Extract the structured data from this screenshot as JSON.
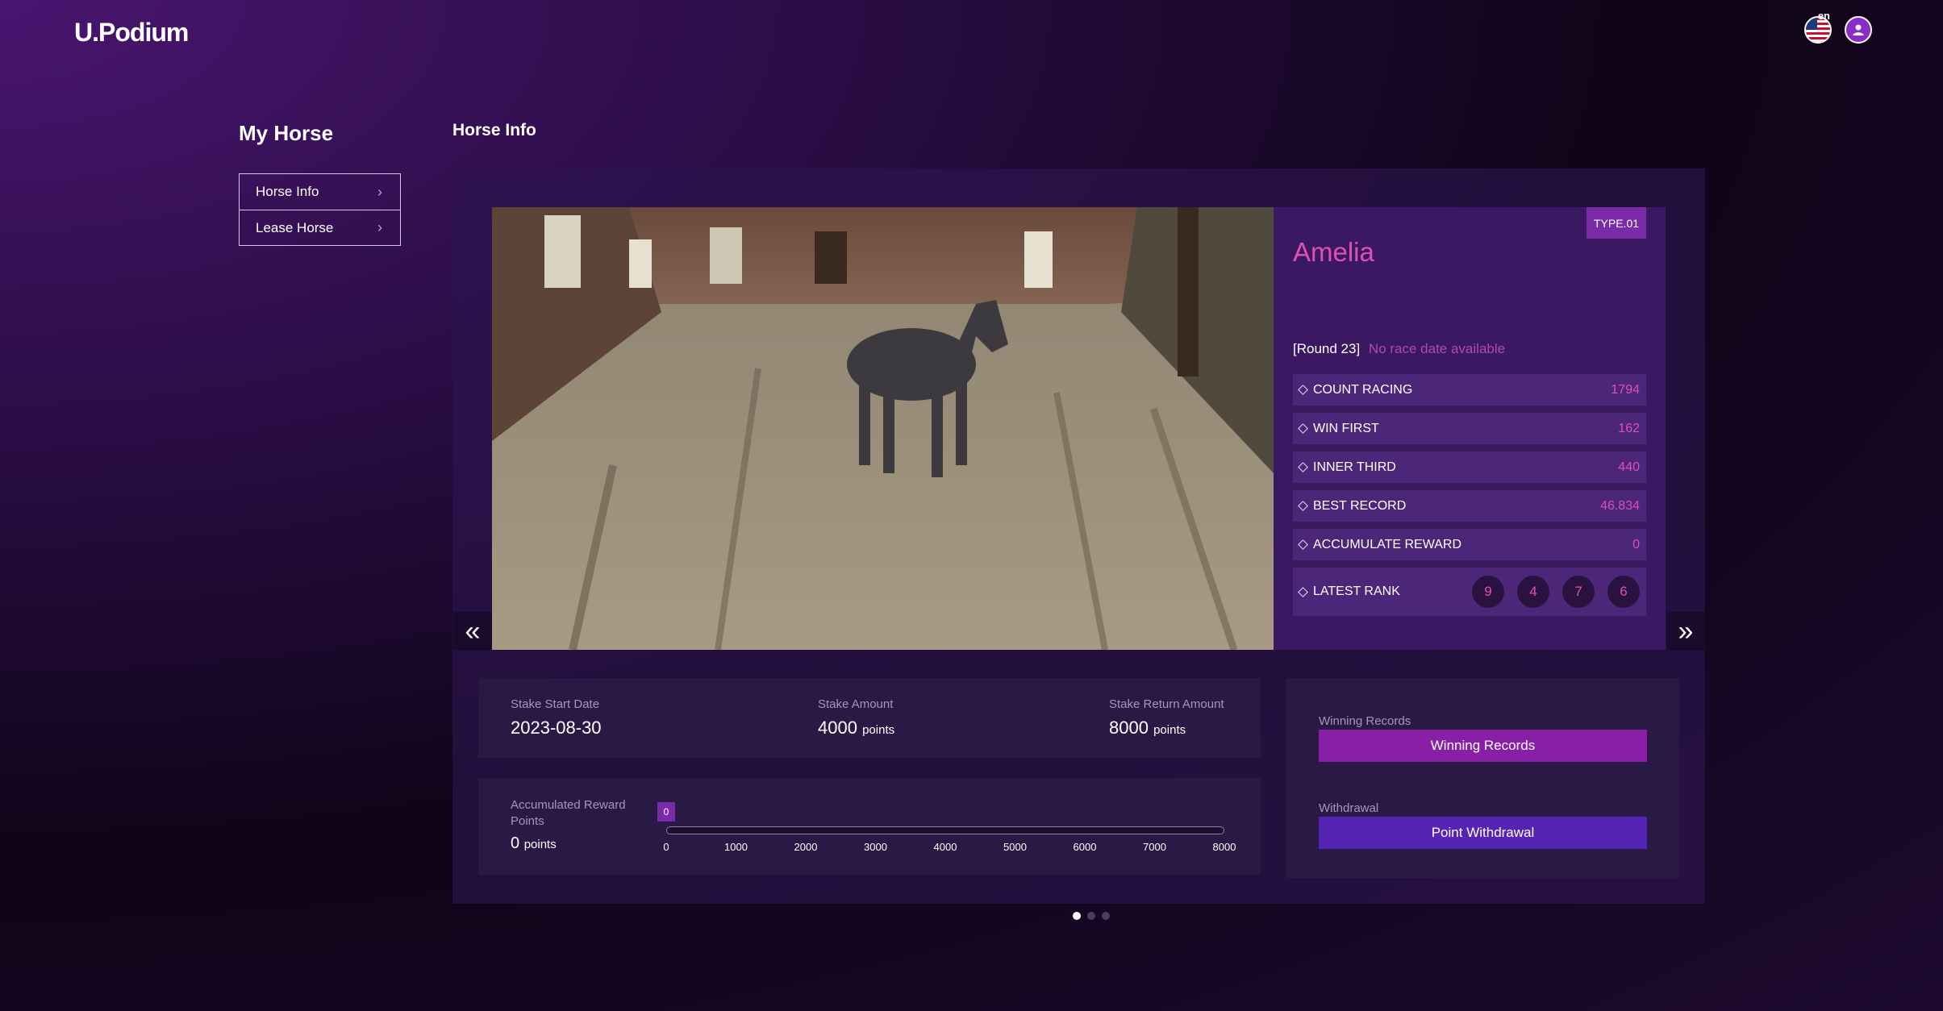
{
  "header": {
    "logo": "U.Podium",
    "language": "en",
    "icons": [
      "us-flag-icon",
      "user-icon"
    ]
  },
  "sidebar": {
    "title": "My Horse",
    "items": [
      {
        "label": "Horse Info"
      },
      {
        "label": "Lease Horse"
      }
    ]
  },
  "main": {
    "title": "Horse Info"
  },
  "horse": {
    "type": "TYPE.01",
    "name": "Amelia",
    "round": "[Round 23]",
    "race_date": "No race date available",
    "stats": [
      {
        "label": "COUNT RACING",
        "value": "1794"
      },
      {
        "label": "WIN FIRST",
        "value": "162"
      },
      {
        "label": "INNER THIRD",
        "value": "440"
      },
      {
        "label": "BEST RECORD",
        "value": "46.834"
      },
      {
        "label": "ACCUMULATE REWARD",
        "value": "0"
      }
    ],
    "latest_rank": {
      "label": "LATEST RANK",
      "values": [
        "9",
        "4",
        "7",
        "6"
      ]
    }
  },
  "stake": {
    "start_date_label": "Stake Start Date",
    "start_date": "2023-08-30",
    "amount_label": "Stake Amount",
    "amount": "4000",
    "return_label": "Stake Return Amount",
    "return_amount": "8000",
    "unit": "points"
  },
  "accumulated": {
    "label": "Accumulated Reward Points",
    "value": "0",
    "unit": "points",
    "slider_value": 0,
    "slider_badge": "0",
    "slider_max": 8000,
    "ticks": [
      "0",
      "1000",
      "2000",
      "3000",
      "4000",
      "5000",
      "6000",
      "7000",
      "8000"
    ]
  },
  "actions": {
    "winning_label": "Winning Records",
    "winning_button": "Winning Records",
    "withdrawal_label": "Withdrawal",
    "withdrawal_button": "Point Withdrawal"
  },
  "carousel": {
    "prev_icon": "double-chevron-left-icon",
    "next_icon": "double-chevron-right-icon",
    "page_count": 3,
    "active_page": 1
  },
  "colors": {
    "accent_pink": "#e04fb5",
    "badge_purple": "#7a2ba7",
    "winning_button": "#8a1fa7",
    "withdraw_button": "#5624b5"
  }
}
